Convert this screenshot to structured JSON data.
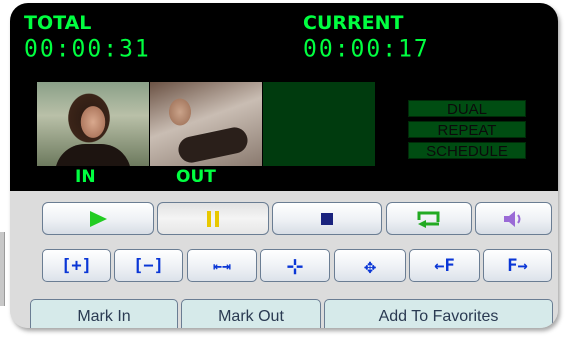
{
  "display": {
    "total_label": "TOTAL",
    "total_time": "00:00:31",
    "current_label": "CURRENT",
    "current_time": "00:00:17",
    "in_label": "IN",
    "out_label": "OUT",
    "modes": [
      "DUAL",
      "REPEAT",
      "SCHEDULE"
    ]
  },
  "transport": {
    "play_icon": "play-icon",
    "pause_icon": "pause-icon",
    "stop_icon": "stop-icon",
    "loop_icon": "loop-icon",
    "volume_icon": "volume-icon"
  },
  "tools": {
    "buttons": [
      {
        "name": "zoom-in-button",
        "icon": "zoom-in-icon",
        "glyph": "[+]"
      },
      {
        "name": "zoom-out-button",
        "icon": "zoom-out-icon",
        "glyph": "[−]"
      },
      {
        "name": "expand-horizontal-button",
        "icon": "expand-horizontal-icon",
        "glyph": "⇤⇥"
      },
      {
        "name": "fit-button",
        "icon": "fit-icon",
        "glyph": "⊹"
      },
      {
        "name": "move-button",
        "icon": "move-icon",
        "glyph": "✥"
      },
      {
        "name": "seek-first-button",
        "icon": "seek-first-icon",
        "glyph": "←F"
      },
      {
        "name": "seek-forward-button",
        "icon": "seek-forward-icon",
        "glyph": "F→"
      }
    ]
  },
  "actions": {
    "mark_in": "Mark In",
    "mark_out": "Mark Out",
    "add_favorites": "Add To Favorites"
  },
  "colors": {
    "lcd_green": "#00ff40",
    "play_green": "#22cc22",
    "pause_yellow": "#e8c800",
    "stop_navy": "#1a237e",
    "loop_green": "#22aa22",
    "volume_purple": "#9a6ad6",
    "tool_blue": "#0a36d6",
    "action_bg": "#d6eaea"
  }
}
